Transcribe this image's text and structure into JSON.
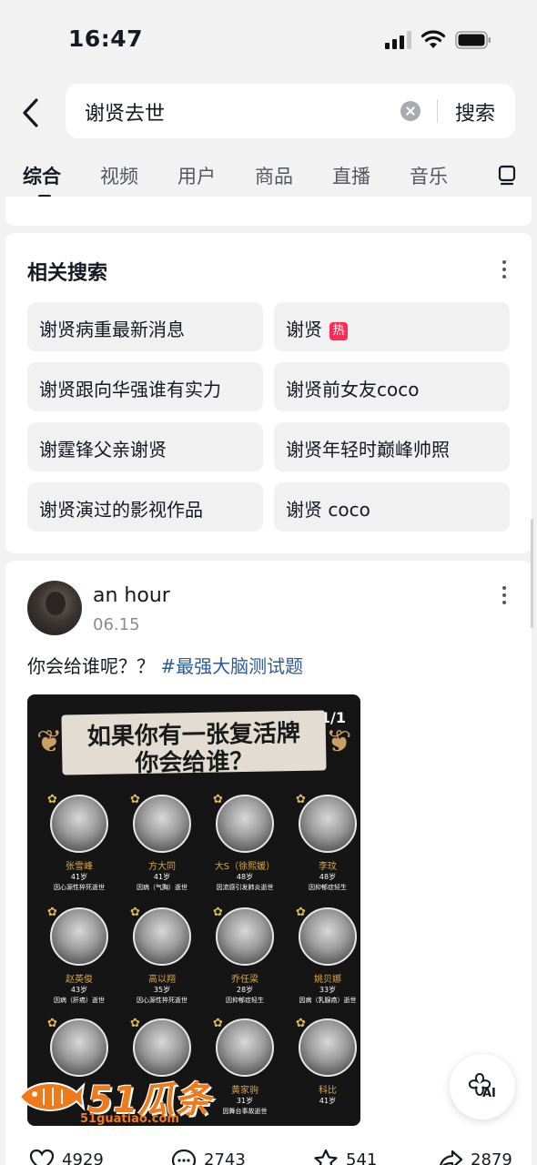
{
  "status_bar": {
    "time": "16:47"
  },
  "search": {
    "query": "谢贤去世",
    "button": "搜索"
  },
  "tabs": [
    "综合",
    "视频",
    "用户",
    "商品",
    "直播",
    "音乐"
  ],
  "related": {
    "title": "相关搜索",
    "items": [
      {
        "label": "谢贤病重最新消息"
      },
      {
        "label": "谢贤",
        "badge": "热"
      },
      {
        "label": "谢贤跟向华强谁有实力"
      },
      {
        "label": "谢贤前女友coco"
      },
      {
        "label": "谢霆锋父亲谢贤"
      },
      {
        "label": "谢贤年轻时巅峰帅照"
      },
      {
        "label": "谢贤演过的影视作品"
      },
      {
        "label": "谢贤 coco"
      }
    ]
  },
  "post": {
    "author": "an hour",
    "date": "06.15",
    "caption_text": "你会给谁呢？？",
    "hashtag": "#最强大脑测试题",
    "image": {
      "counter": "1/1",
      "title_line1": "如果你有一张复活牌",
      "title_line2": "你会给谁？",
      "people": [
        {
          "name": "张雪峰",
          "age": "41岁",
          "cause": "因心源性猝死逝世"
        },
        {
          "name": "方大同",
          "age": "41岁",
          "cause": "因病（气胸）逝世"
        },
        {
          "name": "大S（徐熙媛）",
          "age": "48岁",
          "cause": "因流感引发肺炎逝世"
        },
        {
          "name": "李玟",
          "age": "48岁",
          "cause": "因抑郁症轻生"
        },
        {
          "name": "赵英俊",
          "age": "43岁",
          "cause": "因病（肝癌）逝世"
        },
        {
          "name": "高以翔",
          "age": "35岁",
          "cause": "因心源性猝死逝世"
        },
        {
          "name": "乔任梁",
          "age": "28岁",
          "cause": "因抑郁症轻生"
        },
        {
          "name": "姚贝娜",
          "age": "33岁",
          "cause": "因病（乳腺癌）逝世"
        },
        {
          "name": "",
          "age": "",
          "cause": ""
        },
        {
          "name": "",
          "age": "",
          "cause": ""
        },
        {
          "name": "黄家驹",
          "age": "31岁",
          "cause": "因舞台事故逝世"
        },
        {
          "name": "科比",
          "age": "41岁",
          "cause": ""
        }
      ]
    },
    "stats": {
      "likes": "4929",
      "comments": "2743",
      "favorites": "541",
      "shares": "2879"
    }
  },
  "watermark": {
    "brand": "51瓜条",
    "url": "51guatiao.com"
  },
  "ai_button": {
    "label": "AI"
  },
  "colors": {
    "hot_badge": "#fe2c55",
    "hashtag": "#2a5a9a",
    "watermark": "#f07a1a"
  }
}
